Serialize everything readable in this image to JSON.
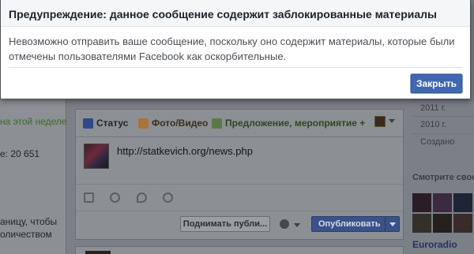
{
  "dialog": {
    "title": "Предупреждение: данное сообщение содержит заблокированные материалы",
    "message_line1": "Невозможно отправить ваше сообщение, поскольку оно содержит материалы, которые были",
    "message_line2": "отмечены пользователями Facebook как оскорбительные.",
    "close_label": "Закрыть"
  },
  "left_sidebar": {
    "week_text": "на этой неделе",
    "likes_text": "е: 20 651",
    "promo_line1": "аницу, чтобы",
    "promo_line2": "оличеством"
  },
  "composer": {
    "tabs": [
      {
        "label": "Статус",
        "icon": "pencil-icon"
      },
      {
        "label": "Фото/Видео",
        "icon": "photo-icon"
      },
      {
        "label": "Предложение, мероприятие +",
        "icon": "offer-icon"
      }
    ],
    "link_text": "http://statkevich.org/news.php",
    "boost_label": "Поднимать публи...",
    "publish_label": "Опубликовать",
    "action_icons": [
      "camera-icon",
      "smiley-icon",
      "location-pin-icon",
      "target-icon"
    ]
  },
  "right_sidebar": {
    "years": [
      "2011 г.",
      "2010 г.",
      "Создано"
    ],
    "see_photos_text": "Смотрите свое р",
    "page_name": "Euroradio"
  },
  "colors": {
    "dialog_button": "#4267b2",
    "overlay": "#7b7f86"
  }
}
